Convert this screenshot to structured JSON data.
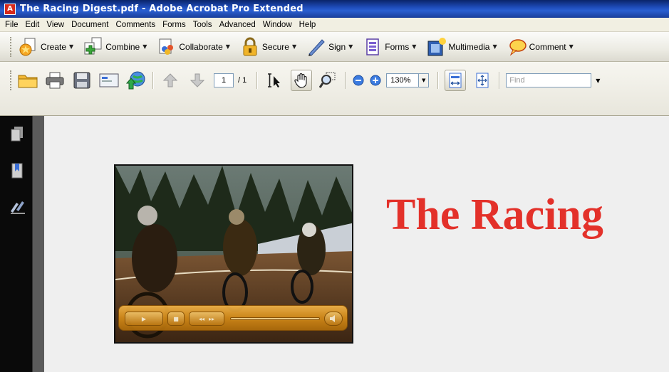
{
  "window": {
    "title": "The Racing Digest.pdf - Adobe Acrobat Pro Extended",
    "app_icon_glyph": "A"
  },
  "menubar": {
    "items": [
      "File",
      "Edit",
      "View",
      "Document",
      "Comments",
      "Forms",
      "Tools",
      "Advanced",
      "Window",
      "Help"
    ]
  },
  "tasks": {
    "items": [
      {
        "label": "Create",
        "icon": "create-icon"
      },
      {
        "label": "Combine",
        "icon": "combine-icon"
      },
      {
        "label": "Collaborate",
        "icon": "collaborate-icon"
      },
      {
        "label": "Secure",
        "icon": "lock-icon"
      },
      {
        "label": "Sign",
        "icon": "pen-icon"
      },
      {
        "label": "Forms",
        "icon": "form-icon"
      },
      {
        "label": "Multimedia",
        "icon": "film-icon"
      },
      {
        "label": "Comment",
        "icon": "speech-bubble-icon"
      }
    ],
    "dropdown_glyph": "▼"
  },
  "toolbar": {
    "current_page": "1",
    "page_count": "/ 1",
    "zoom": "130%",
    "find_placeholder": "Find",
    "dropdown_glyph": "▼"
  },
  "video": {
    "play_glyph": "▶",
    "stop_glyph": "■",
    "rewind_glyph": "◂◂",
    "forward_glyph": "▸▸",
    "progress": 0.0,
    "accent": "#d48b18"
  },
  "document": {
    "title_text": "The Racing",
    "title_color": "#e3312a"
  }
}
